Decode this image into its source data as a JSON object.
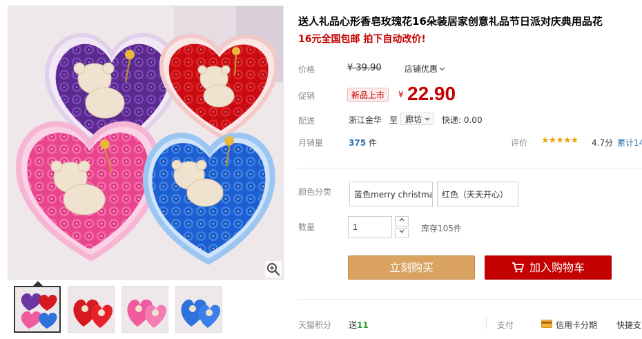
{
  "product": {
    "title": "送人礼品心形香皂玫瑰花16朵装居家创意礼品节日派对庆典用品花",
    "promo": "16元全国包邮 拍下自动改价!"
  },
  "price": {
    "label": "价格",
    "original": "¥ 39.90",
    "shop_discount": "店铺优惠"
  },
  "promo_price": {
    "label": "促销",
    "badge": "新品上市",
    "currency": "¥",
    "value": "22.90"
  },
  "delivery": {
    "label": "配送",
    "from": "浙江金华",
    "to_word": "至",
    "to_city": "廊坊",
    "express": "快递: 0.00"
  },
  "stats": {
    "monthly_sales_label": "月销量",
    "monthly_sales_value": "375",
    "monthly_sales_unit": "件",
    "rating_label": "评价",
    "stars": "★★★★★",
    "score": "4.7分",
    "accumulated": "累计14"
  },
  "sku": {
    "label": "颜色分类",
    "options": [
      "蓝色merry christmas",
      "红色（天天开心）"
    ]
  },
  "quantity": {
    "label": "数量",
    "value": "1",
    "stock": "库存105件"
  },
  "actions": {
    "buy_now": "立刻购买",
    "add_to_cart": "加入购物车"
  },
  "footer": {
    "points_label": "天猫积分",
    "points_prefix": "送",
    "points_value": "11",
    "pay_label": "支付",
    "card_installment": "信用卡分期",
    "quick_pay": "快捷支"
  },
  "colors": {
    "price_red": "#c40000",
    "buy_button": "#d9a261",
    "cart_button": "#c40000",
    "link_blue": "#2a6fb3",
    "star": "#f1a200"
  },
  "icons": {
    "magnify": "magnify-icon",
    "cart": "cart-icon",
    "card": "credit-card-icon",
    "chevron": "chevron-down-icon"
  }
}
